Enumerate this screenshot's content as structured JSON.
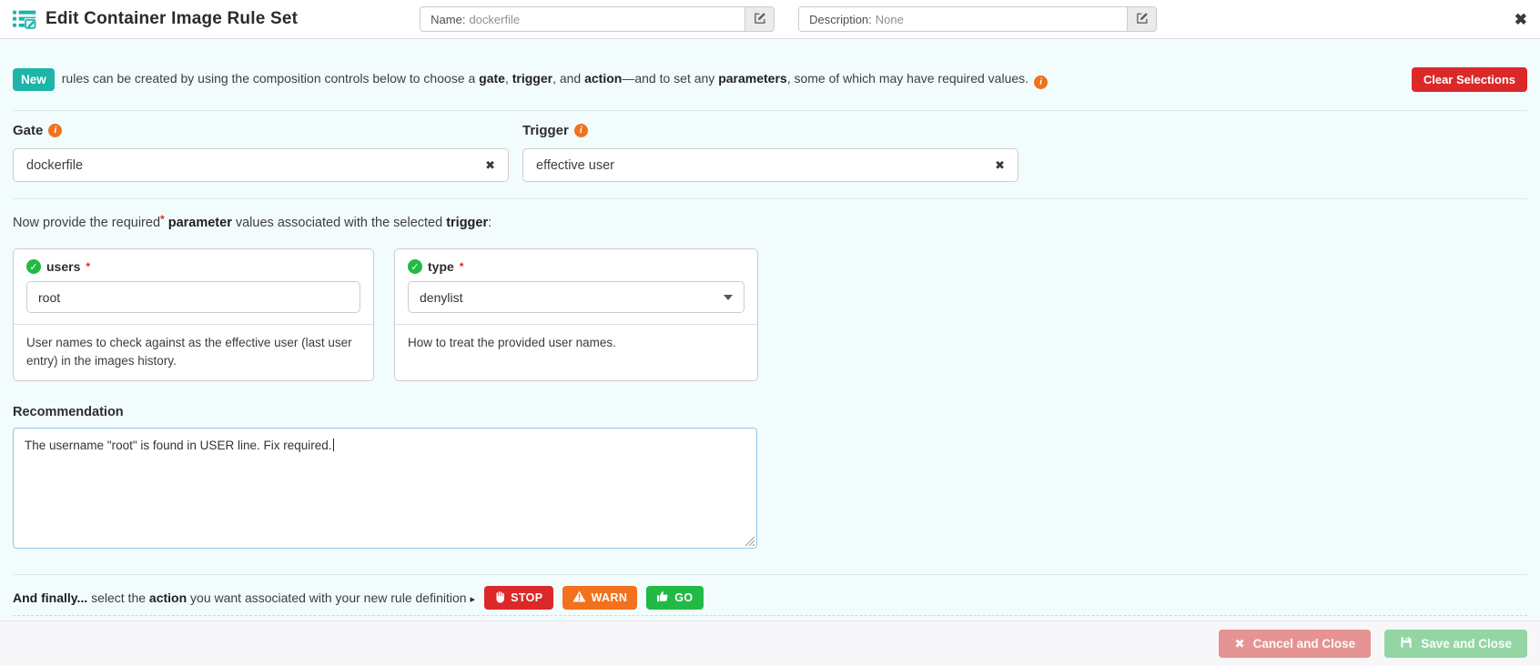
{
  "accent_colors": {
    "teal": "#1cb5a8",
    "red": "#db2828",
    "orange": "#f2711c",
    "green": "#21ba45",
    "azure_bg": "#f3fcfd",
    "focus_border": "#8fc7e8",
    "cancel_bg": "#e59393",
    "save_bg": "#93d6a4"
  },
  "icons": {
    "close": "✖",
    "clear": "✖",
    "check": "✓",
    "info": "i",
    "caret_right": "▸"
  },
  "header": {
    "title": "Edit Container Image Rule Set",
    "name_label": "Name:",
    "name_value": "dockerfile",
    "description_label": "Description:",
    "description_value": "None"
  },
  "banner": {
    "badge": "New",
    "text_1": "rules can be created by using the composition controls below to choose a ",
    "bold_gate": "gate",
    "sep_1": ", ",
    "bold_trigger": "trigger",
    "sep_2": ", and ",
    "bold_action": "action",
    "text_2": "—and to set any ",
    "bold_parameters": "parameters",
    "text_3": ", some of which may have required values.",
    "clear_button": "Clear Selections"
  },
  "composition": {
    "gate_label": "Gate",
    "gate_value": "dockerfile",
    "trigger_label": "Trigger",
    "trigger_value": "effective user"
  },
  "parameters": {
    "intro_1": "Now provide the required",
    "required_star": "*",
    "intro_sp": " ",
    "intro_bold_parameter": "parameter",
    "intro_2": " values associated with the selected ",
    "intro_bold_trigger": "trigger",
    "intro_3": ":",
    "cards": [
      {
        "name": "users",
        "required": "*",
        "value": "root",
        "description": "User names to check against as the effective user (last user entry) in the images history."
      },
      {
        "name": "type",
        "required": "*",
        "value": "denylist",
        "description": "How to treat the provided user names."
      }
    ]
  },
  "recommendation": {
    "label": "Recommendation",
    "value": "The username \"root\" is found in USER line. Fix required."
  },
  "actions": {
    "intro_bold": "And finally...",
    "intro_text_1": " select the ",
    "intro_bold_action": "action",
    "intro_text_2": " you want associated with your new rule definition",
    "stop": "STOP",
    "warn": "WARN",
    "go": "GO"
  },
  "footer": {
    "cancel": "Cancel and Close",
    "save": "Save and Close"
  }
}
